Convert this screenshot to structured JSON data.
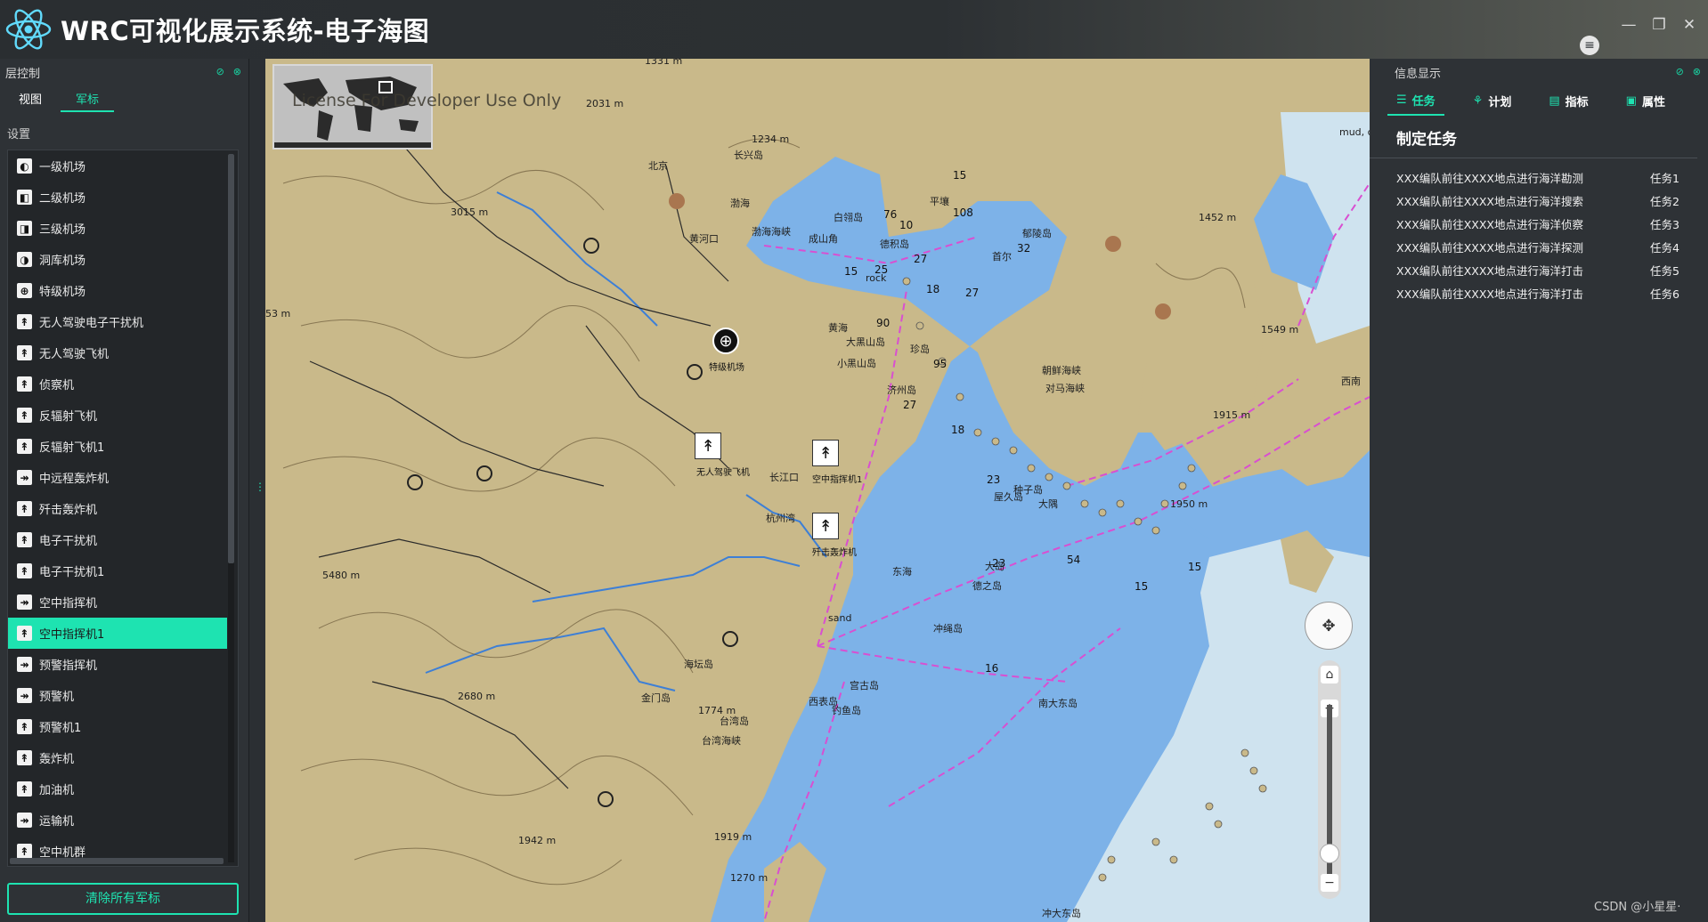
{
  "app": {
    "title": "WRC可视化展示系统-电子海图",
    "menu_icon": "hamburger-icon"
  },
  "window_controls": {
    "minimize": "—",
    "restore": "❐",
    "close": "✕"
  },
  "left_panel": {
    "header": "层控制",
    "tabs": [
      {
        "label": "视图",
        "active": false
      },
      {
        "label": "军标",
        "active": true
      }
    ],
    "section_label": "设置",
    "items": [
      {
        "label": "一级机场",
        "icon": "◐"
      },
      {
        "label": "二级机场",
        "icon": "◧"
      },
      {
        "label": "三级机场",
        "icon": "◨"
      },
      {
        "label": "洞库机场",
        "icon": "◑"
      },
      {
        "label": "特级机场",
        "icon": "⊕"
      },
      {
        "label": "无人驾驶电子干扰机",
        "icon": "↟"
      },
      {
        "label": "无人驾驶飞机",
        "icon": "↟"
      },
      {
        "label": "侦察机",
        "icon": "↟"
      },
      {
        "label": "反辐射飞机",
        "icon": "↟"
      },
      {
        "label": "反辐射飞机1",
        "icon": "↟"
      },
      {
        "label": "中远程轰炸机",
        "icon": "↠"
      },
      {
        "label": "歼击轰炸机",
        "icon": "↟"
      },
      {
        "label": "电子干扰机",
        "icon": "↟"
      },
      {
        "label": "电子干扰机1",
        "icon": "↟"
      },
      {
        "label": "空中指挥机",
        "icon": "↠"
      },
      {
        "label": "空中指挥机1",
        "icon": "↟",
        "selected": true
      },
      {
        "label": "预警指挥机",
        "icon": "↠"
      },
      {
        "label": "预警机",
        "icon": "↠"
      },
      {
        "label": "预警机1",
        "icon": "↟"
      },
      {
        "label": "轰炸机",
        "icon": "↟"
      },
      {
        "label": "加油机",
        "icon": "↟"
      },
      {
        "label": "运输机",
        "icon": "↠"
      },
      {
        "label": "空中机群",
        "icon": "↟"
      }
    ],
    "clear_button": "清除所有军标"
  },
  "map": {
    "license_text": "License For Developer Use Only",
    "place_labels": [
      {
        "text": "北京"
      },
      {
        "text": "渤海"
      },
      {
        "text": "长兴岛"
      },
      {
        "text": "渤海海峡"
      },
      {
        "text": "白翎岛"
      },
      {
        "text": "黄河口"
      },
      {
        "text": "成山角"
      },
      {
        "text": "德积岛"
      },
      {
        "text": "平壤"
      },
      {
        "text": "首尔"
      },
      {
        "text": "黄海"
      },
      {
        "text": "大黑山岛"
      },
      {
        "text": "小黑山岛"
      },
      {
        "text": "珍岛"
      },
      {
        "text": "济州岛"
      },
      {
        "text": "朝鲜海峡"
      },
      {
        "text": "对马海峡"
      },
      {
        "text": "长江口"
      },
      {
        "text": "杭州湾"
      },
      {
        "text": "东海"
      },
      {
        "text": "德之岛"
      },
      {
        "text": "大岛"
      },
      {
        "text": "冲绳岛"
      },
      {
        "text": "种子岛"
      },
      {
        "text": "屋久岛"
      },
      {
        "text": "海坛岛"
      },
      {
        "text": "金门岛"
      },
      {
        "text": "台湾岛"
      },
      {
        "text": "台湾海峡"
      },
      {
        "text": "宫古岛"
      },
      {
        "text": "西表岛"
      },
      {
        "text": "钓鱼岛"
      },
      {
        "text": "郁陵岛"
      },
      {
        "text": "mud, c"
      },
      {
        "text": "西南"
      },
      {
        "text": "大隅"
      },
      {
        "text": "南大东岛"
      },
      {
        "text": "冲大东岛"
      },
      {
        "text": "rock"
      },
      {
        "text": "sand"
      }
    ],
    "elevations": [
      {
        "text": "1331 m"
      },
      {
        "text": "2031 m"
      },
      {
        "text": "1234 m"
      },
      {
        "text": "3015 m"
      },
      {
        "text": "53 m"
      },
      {
        "text": "5480 m"
      },
      {
        "text": "2680 m"
      },
      {
        "text": "1774 m"
      },
      {
        "text": "1942 m"
      },
      {
        "text": "1919 m"
      },
      {
        "text": "1270 m"
      },
      {
        "text": "1452 m"
      },
      {
        "text": "1549 m"
      },
      {
        "text": "1915 m"
      },
      {
        "text": "1950 m"
      }
    ],
    "depths": [
      {
        "text": "15"
      },
      {
        "text": "76"
      },
      {
        "text": "10"
      },
      {
        "text": "108"
      },
      {
        "text": "27"
      },
      {
        "text": "25"
      },
      {
        "text": "15"
      },
      {
        "text": "18"
      },
      {
        "text": "27"
      },
      {
        "text": "32"
      },
      {
        "text": "90"
      },
      {
        "text": "95"
      },
      {
        "text": "27"
      },
      {
        "text": "18"
      },
      {
        "text": "23"
      },
      {
        "text": "23"
      },
      {
        "text": "54"
      },
      {
        "text": "15"
      },
      {
        "text": "16"
      },
      {
        "text": "15"
      }
    ],
    "markers": [
      {
        "label": "特级机场",
        "icon": "⊕"
      },
      {
        "label": "无人驾驶飞机",
        "icon": "↟"
      },
      {
        "label": "空中指挥机1",
        "icon": "↟"
      },
      {
        "label": "歼击轰炸机",
        "icon": "↟"
      }
    ],
    "zoom_in": "+",
    "zoom_out": "−",
    "home": "⌂",
    "pan": "✥"
  },
  "right_panel": {
    "header": "信息显示",
    "tabs": [
      {
        "label": "任务",
        "icon": "list-icon",
        "active": true
      },
      {
        "label": "计划",
        "icon": "sitemap-icon",
        "active": false
      },
      {
        "label": "指标",
        "icon": "card-icon",
        "active": false
      },
      {
        "label": "属性",
        "icon": "person-icon",
        "active": false
      }
    ],
    "title": "制定任务",
    "tasks": [
      {
        "desc": "XXX编队前往XXXX地点进行海洋勘测",
        "name": "任务1"
      },
      {
        "desc": "XXX编队前往XXXX地点进行海洋搜索",
        "name": "任务2"
      },
      {
        "desc": "XXX编队前往XXXX地点进行海洋侦察",
        "name": "任务3"
      },
      {
        "desc": "XXX编队前往XXXX地点进行海洋探测",
        "name": "任务4"
      },
      {
        "desc": "XXX编队前往XXXX地点进行海洋打击",
        "name": "任务5"
      },
      {
        "desc": "XXX编队前往XXXX地点进行海洋打击",
        "name": "任务6"
      }
    ]
  },
  "watermark": "CSDN @小星星·",
  "colors": {
    "accent": "#1ee3b1",
    "land": "#c9b98a",
    "sea": "#7db2e8",
    "shallow": "#cfe3ef",
    "route": "#d94fd1"
  }
}
